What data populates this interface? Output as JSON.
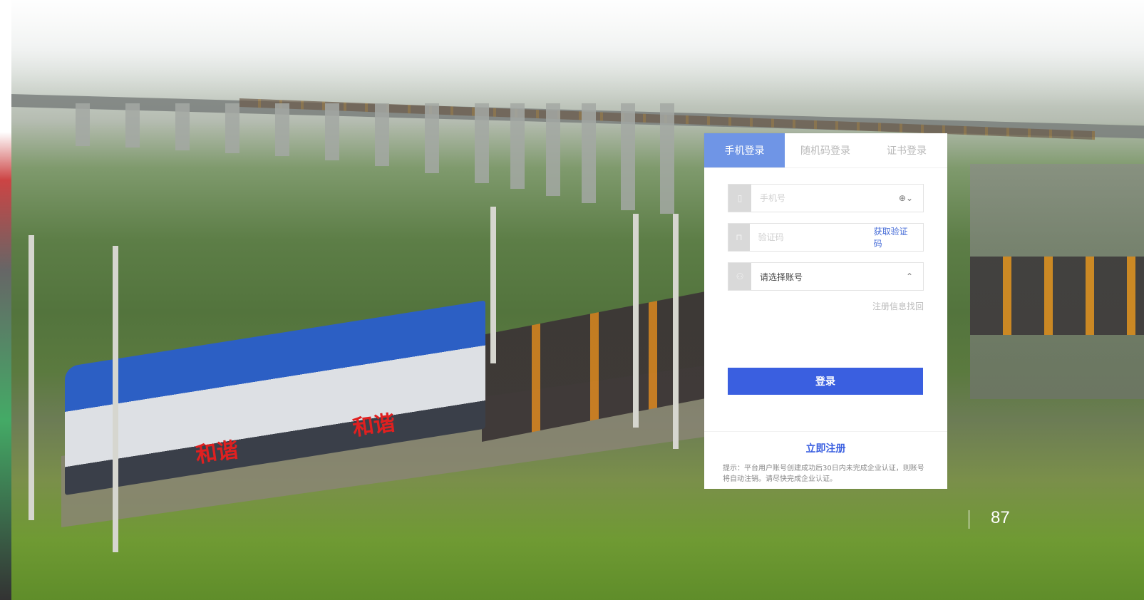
{
  "tabs": [
    {
      "label": "手机登录",
      "active": true
    },
    {
      "label": "随机码登录",
      "active": false
    },
    {
      "label": "证书登录",
      "active": false
    }
  ],
  "phone_field": {
    "placeholder": "手机号",
    "lead_icon": "phone-icon",
    "trail_icon": "region-dropdown-icon",
    "trail_label": "⊕⌄"
  },
  "code_field": {
    "placeholder": "验证码",
    "lead_icon": "lock-icon",
    "get_code_label": "获取验证码"
  },
  "account_field": {
    "value": "请选择账号",
    "lead_icon": "user-icon",
    "chevron": "⌃"
  },
  "recover_link": "注册信息找回",
  "login_button": "登录",
  "register_link": "立即注册",
  "notice": "提示：平台用户账号创建成功后30日内未完成企业认证，则账号将自动注销。请尽快完成企业认证。",
  "page_number": "87",
  "loco_text": "和谐",
  "colors": {
    "accent": "#3a5fe0",
    "tab_active": "#6f95e6"
  }
}
